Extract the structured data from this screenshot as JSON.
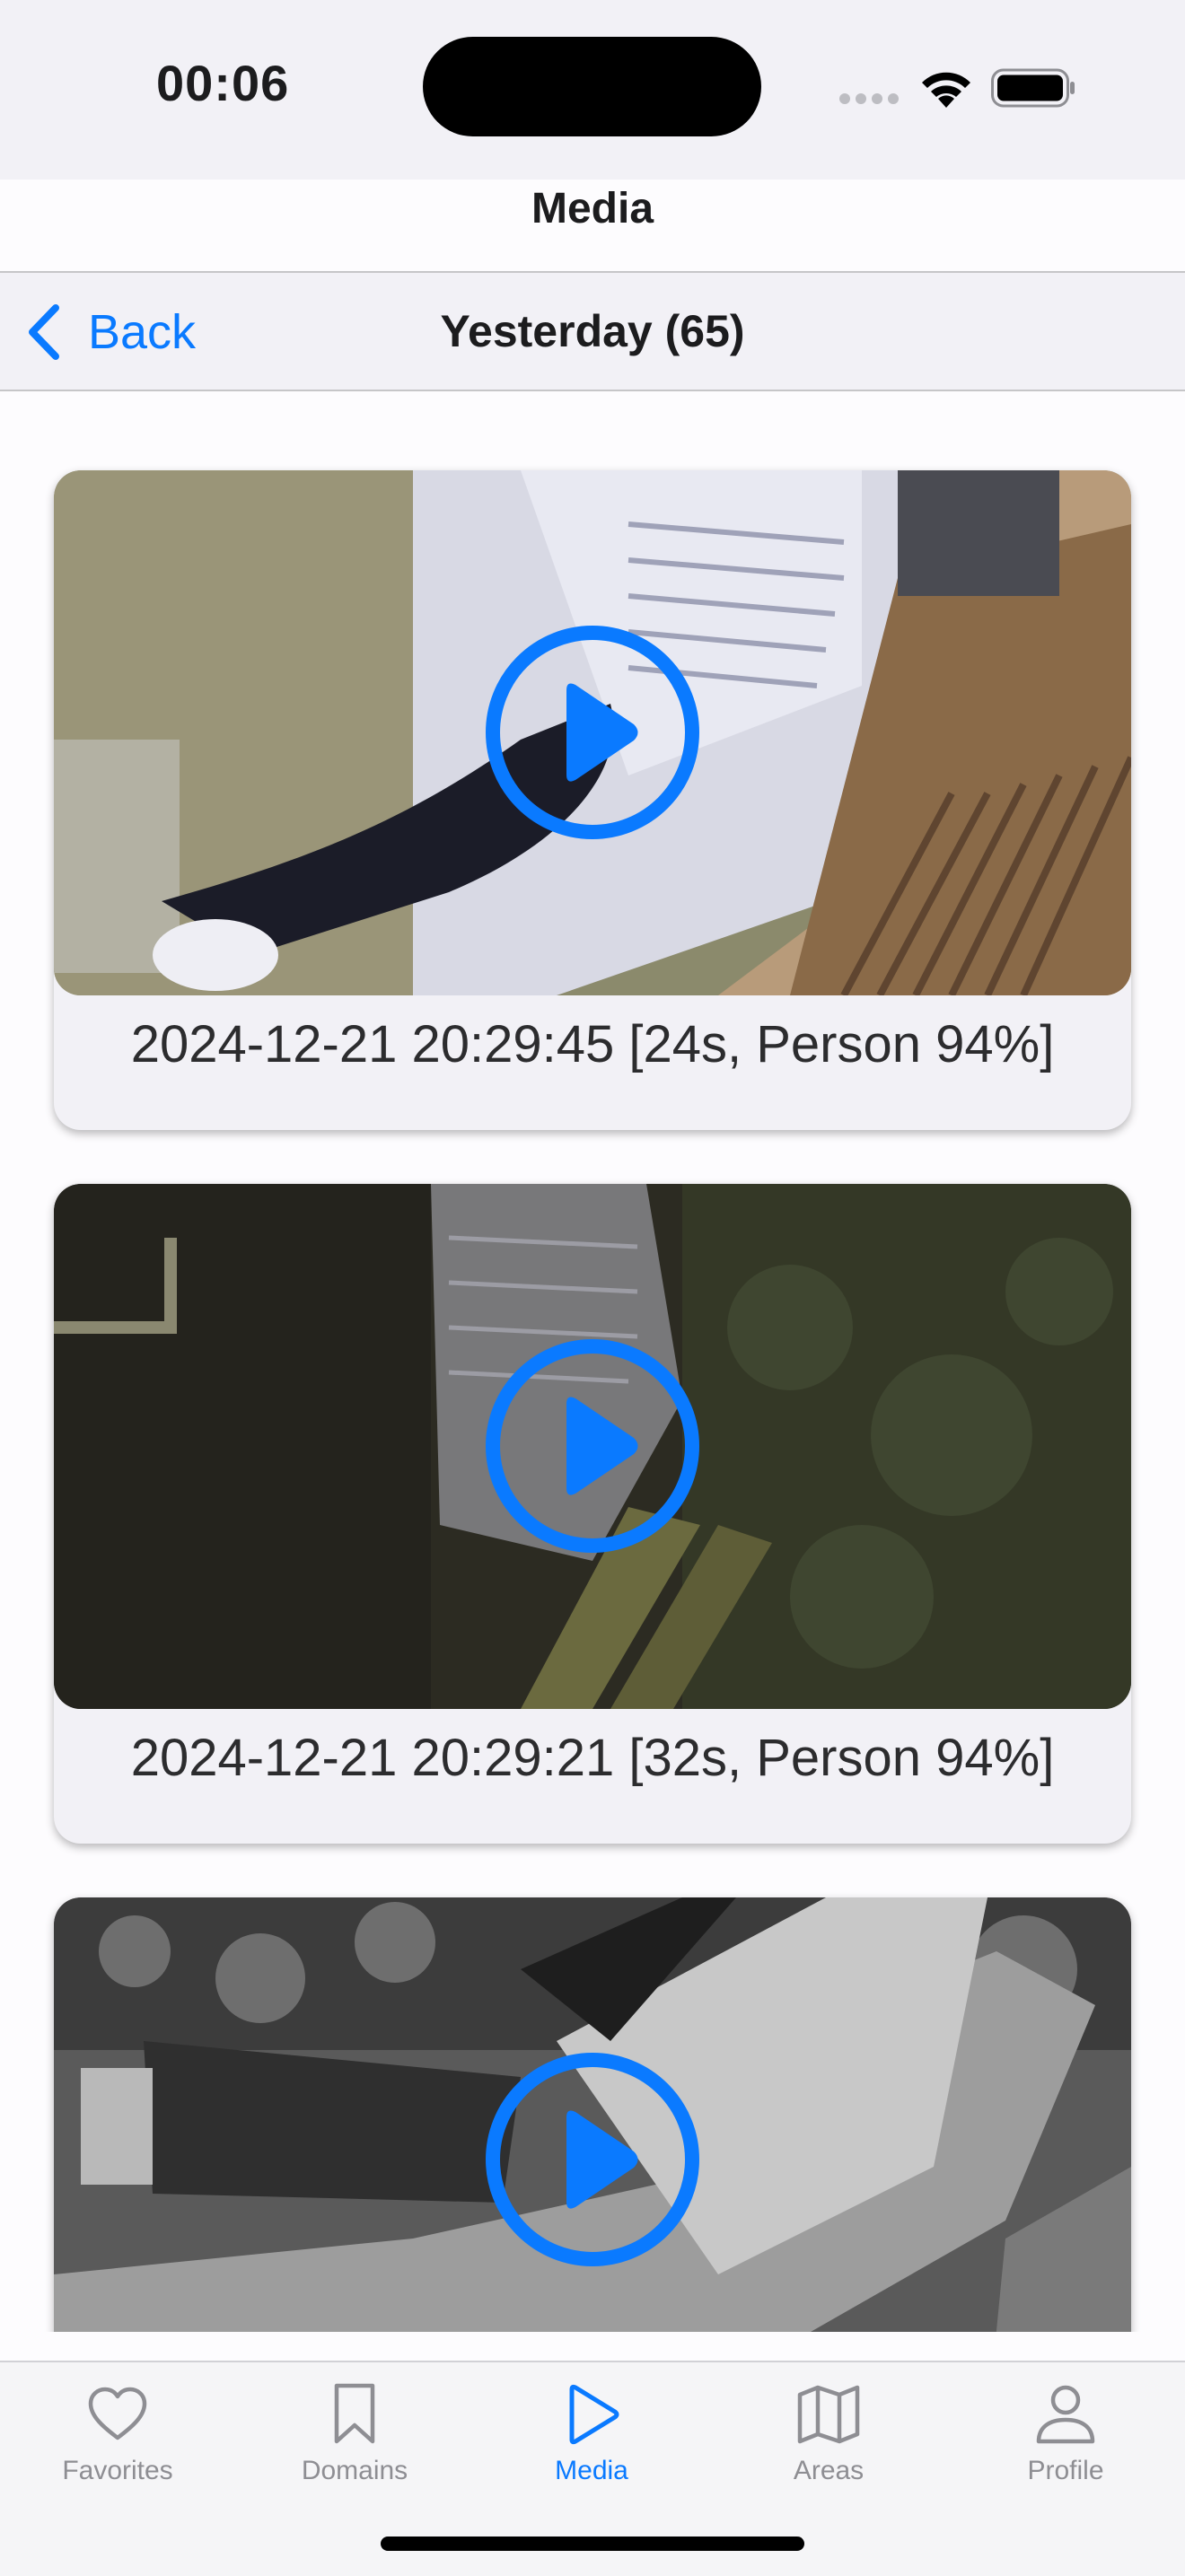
{
  "status_bar": {
    "time": "00:06",
    "icons": [
      "cellular-signal-icon",
      "wifi-icon",
      "battery-icon"
    ]
  },
  "header": {
    "title": "Media"
  },
  "nav": {
    "back_label": "Back",
    "title": "Yesterday (65)"
  },
  "media_items": [
    {
      "caption": "2024-12-21 20:29:45 [24s, Person 94%]",
      "icon": "play-circle-icon"
    },
    {
      "caption": "2024-12-21 20:29:21 [32s, Person 94%]",
      "icon": "play-circle-icon"
    },
    {
      "caption": "",
      "icon": "play-circle-icon"
    }
  ],
  "tab_bar": {
    "tabs": [
      {
        "label": "Favorites",
        "icon": "heart-icon",
        "active": false
      },
      {
        "label": "Domains",
        "icon": "bookmark-icon",
        "active": false
      },
      {
        "label": "Media",
        "icon": "play-icon",
        "active": true
      },
      {
        "label": "Areas",
        "icon": "map-icon",
        "active": false
      },
      {
        "label": "Profile",
        "icon": "person-icon",
        "active": false
      }
    ]
  },
  "colors": {
    "accent": "#0a7aff",
    "inactive_tab": "#8e8e93",
    "bar_background": "#f2f1f6"
  }
}
